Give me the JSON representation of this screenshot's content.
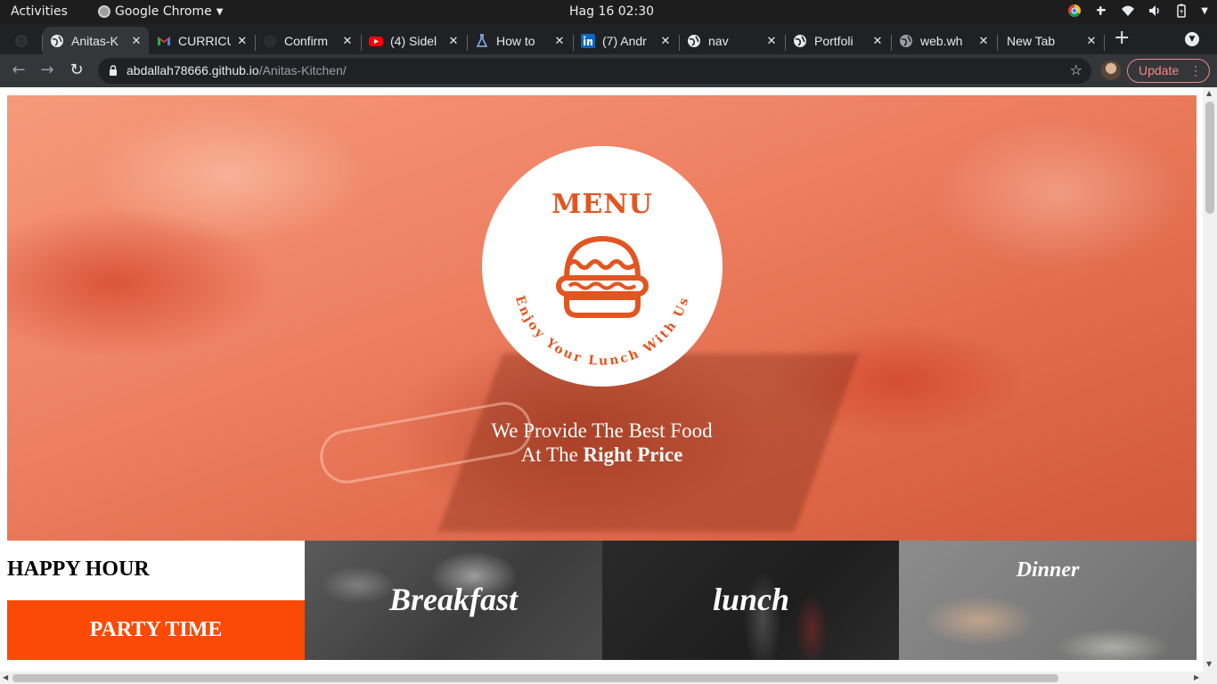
{
  "system_bar": {
    "activities": "Activities",
    "app_name": "Google Chrome",
    "clock": "Hag 16  02:30"
  },
  "tabs": [
    {
      "title": "",
      "icon": "github-icon",
      "active": false
    },
    {
      "title": "Anitas-K",
      "icon": "globe-icon",
      "active": true
    },
    {
      "title": "CURRICU",
      "icon": "gmail-icon",
      "active": false
    },
    {
      "title": "Confirm",
      "icon": "github-icon",
      "active": false
    },
    {
      "title": "(4) Sidel",
      "icon": "youtube-icon",
      "active": false
    },
    {
      "title": "How to",
      "icon": "flask-icon",
      "active": false
    },
    {
      "title": "(7) Andr",
      "icon": "linkedin-icon",
      "active": false
    },
    {
      "title": "nav",
      "icon": "globe-icon",
      "active": false
    },
    {
      "title": "Portfoli",
      "icon": "globe-icon",
      "active": false
    },
    {
      "title": "web.wh",
      "icon": "globe-icon",
      "active": false
    },
    {
      "title": "New Tab",
      "icon": "",
      "active": false
    }
  ],
  "new_tab_symbol": "+",
  "address_bar": {
    "host": "abdallah78666.github.io",
    "path": "/Anitas-Kitchen/"
  },
  "update_button": "Update",
  "hero": {
    "menu_title": "MENU",
    "menu_subtitle": "Enjoy Your Lunch With Us",
    "tagline_line1": "We Provide The Best Food",
    "tagline_line2_prefix": "At The",
    "tagline_line2_bold": "Right Price"
  },
  "tiles": {
    "happy_hour": "HAPPY HOUR",
    "party_time": "PARTY TIME",
    "breakfast": "Breakfast",
    "lunch": "lunch",
    "dinner": "Dinner"
  },
  "colors": {
    "accent_orange": "#fa4a05",
    "menu_orange": "#e35520",
    "update_red": "#f28b82"
  }
}
